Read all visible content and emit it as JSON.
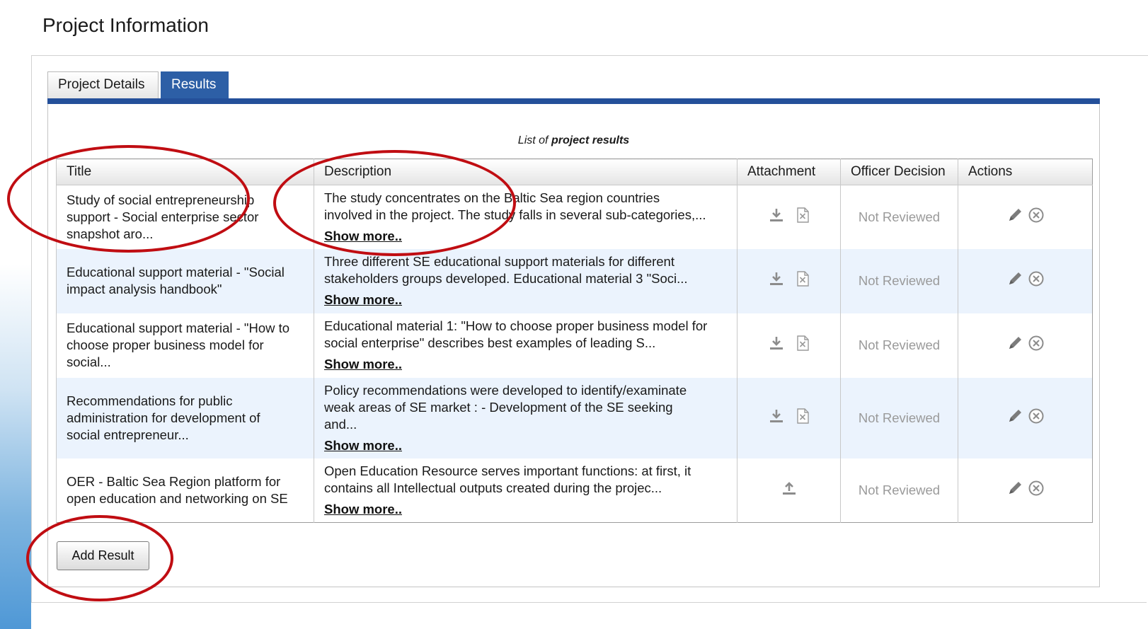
{
  "page": {
    "title": "Project Information"
  },
  "tabs": [
    {
      "label": "Project Details",
      "active": false
    },
    {
      "label": "Results",
      "active": true
    }
  ],
  "table": {
    "caption_prefix": "List of",
    "caption_bold": "project results",
    "headers": [
      "Title",
      "Description",
      "Attachment",
      "Officer Decision",
      "Actions"
    ],
    "show_more_label": "Show more..",
    "rows": [
      {
        "title_lines": [
          "Study of social entrepreneurship",
          "support - Social enterprise sector",
          "snapshot aro..."
        ],
        "desc_lines": [
          "The study concentrates on the Baltic Sea region countries",
          "involved in the project. The study falls in several sub-categories,..."
        ],
        "attachment": [
          "download-icon",
          "delete-file-icon"
        ],
        "decision": "Not Reviewed"
      },
      {
        "title_lines": [
          "Educational support material - \"Social",
          "impact analysis handbook\""
        ],
        "desc_lines": [
          "Three different SE educational support materials for different",
          "stakeholders groups developed. Educational material 3 \"Soci..."
        ],
        "attachment": [
          "download-icon",
          "delete-file-icon"
        ],
        "decision": "Not Reviewed"
      },
      {
        "title_lines": [
          "Educational support material - \"How to",
          "choose proper business model for",
          "social..."
        ],
        "desc_lines": [
          "Educational material 1: \"How to choose proper business model for",
          "social enterprise\" describes best examples of leading S..."
        ],
        "attachment": [
          "download-icon",
          "delete-file-icon"
        ],
        "decision": "Not Reviewed"
      },
      {
        "title_lines": [
          "Recommendations for public",
          "administration for development of",
          "social entrepreneur..."
        ],
        "desc_lines": [
          "Policy recommendations were developed to identify/examinate",
          "weak areas of SE market : - Development of the SE seeking",
          "and..."
        ],
        "attachment": [
          "download-icon",
          "delete-file-icon"
        ],
        "decision": "Not Reviewed"
      },
      {
        "title_lines": [
          "OER - Baltic Sea Region platform for",
          "open education and networking on SE"
        ],
        "desc_lines": [
          "Open Education Resource serves important functions: at first, it",
          "contains all Intellectual outputs created during the projec..."
        ],
        "attachment": [
          "upload-icon"
        ],
        "decision": "Not Reviewed"
      }
    ],
    "actions": [
      "edit-pencil-icon",
      "remove-circle-icon"
    ]
  },
  "buttons": {
    "add_result": "Add Result"
  },
  "colors": {
    "tab_active": "#2d5fa6",
    "tab_bar": "#24509a",
    "alt_row": "#ebf3fd",
    "annotation_oval": "#c00d12",
    "status_text": "#9a9a9a"
  }
}
